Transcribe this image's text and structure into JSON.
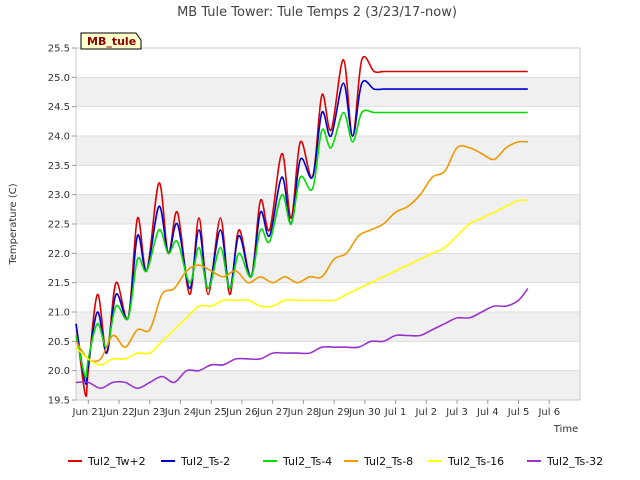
{
  "chart_data": {
    "type": "line",
    "title": "MB Tule Tower: Tule Temps 2 (3/23/17-now)",
    "site_label": "MB_tule",
    "xlabel": "Time",
    "ylabel": "Temperature (C)",
    "x_unit": "day (June/July 2017)",
    "xlim": [
      20.6,
      37.0
    ],
    "ylim": [
      19.5,
      25.5
    ],
    "x_ticks": [
      {
        "value": 21,
        "label": "Jun 21"
      },
      {
        "value": 22,
        "label": "Jun 22"
      },
      {
        "value": 23,
        "label": "Jun 23"
      },
      {
        "value": 24,
        "label": "Jun 24"
      },
      {
        "value": 25,
        "label": "Jun 25"
      },
      {
        "value": 26,
        "label": "Jun 26"
      },
      {
        "value": 27,
        "label": "Jun 27"
      },
      {
        "value": 28,
        "label": "Jun 28"
      },
      {
        "value": 29,
        "label": "Jun 29"
      },
      {
        "value": 30,
        "label": "Jun 30"
      },
      {
        "value": 31,
        "label": "Jul 1"
      },
      {
        "value": 32,
        "label": "Jul 2"
      },
      {
        "value": 33,
        "label": "Jul 3"
      },
      {
        "value": 34,
        "label": "Jul 4"
      },
      {
        "value": 35,
        "label": "Jul 5"
      },
      {
        "value": 36,
        "label": "Jul 6"
      }
    ],
    "y_ticks": [
      "19.5",
      "20.0",
      "20.5",
      "21.0",
      "21.5",
      "22.0",
      "22.5",
      "23.0",
      "23.5",
      "24.0",
      "24.5",
      "25.0",
      "25.5"
    ],
    "grid": true,
    "legend_position": "bottom",
    "series": [
      {
        "name": "Tul2_Tw+2",
        "color": "#dd0000",
        "x": [
          20.6,
          20.9,
          21.0,
          21.3,
          21.6,
          21.9,
          22.3,
          22.6,
          22.9,
          23.3,
          23.6,
          23.9,
          24.3,
          24.6,
          24.9,
          25.3,
          25.6,
          25.9,
          26.3,
          26.6,
          26.9,
          27.3,
          27.6,
          27.9,
          28.3,
          28.6,
          28.9,
          29.3,
          29.6,
          29.9,
          30.3,
          30.6,
          30.9,
          31.3,
          31.6,
          31.9,
          32.3,
          32.6,
          32.9,
          33.3,
          33.6,
          33.9,
          34.3,
          34.6,
          34.9,
          35.3
        ],
        "y": [
          20.8,
          19.6,
          20.0,
          21.3,
          20.3,
          21.5,
          20.9,
          22.6,
          21.7,
          23.2,
          22.0,
          22.7,
          21.3,
          22.6,
          21.3,
          22.6,
          21.3,
          22.4,
          21.6,
          22.9,
          22.4,
          23.7,
          22.6,
          23.9,
          23.3,
          24.7,
          24.1,
          25.3,
          24.0,
          25.3,
          25.1,
          25.1,
          25.1,
          25.1,
          25.1,
          25.1,
          25.1,
          25.1,
          25.1,
          25.1,
          25.1,
          25.1,
          25.1,
          25.1,
          25.1,
          25.1
        ]
      },
      {
        "name": "Tul2_Ts-2",
        "color": "#0000cc",
        "x": [
          20.6,
          20.9,
          21.0,
          21.3,
          21.6,
          21.9,
          22.3,
          22.6,
          22.9,
          23.3,
          23.6,
          23.9,
          24.3,
          24.6,
          24.9,
          25.3,
          25.6,
          25.9,
          26.3,
          26.6,
          26.9,
          27.3,
          27.6,
          27.9,
          28.3,
          28.6,
          28.9,
          29.3,
          29.6,
          29.9,
          30.3,
          30.6,
          30.9,
          31.3,
          31.6,
          31.9,
          32.3,
          32.6,
          32.9,
          33.3,
          33.6,
          33.9,
          34.3,
          34.6,
          34.9,
          35.3
        ],
        "y": [
          20.8,
          19.8,
          20.1,
          21.0,
          20.3,
          21.3,
          20.9,
          22.3,
          21.7,
          22.8,
          22.0,
          22.5,
          21.4,
          22.4,
          21.4,
          22.4,
          21.4,
          22.3,
          21.6,
          22.7,
          22.3,
          23.3,
          22.5,
          23.6,
          23.3,
          24.4,
          24.0,
          24.9,
          24.0,
          24.9,
          24.8,
          24.8,
          24.8,
          24.8,
          24.8,
          24.8,
          24.8,
          24.8,
          24.8,
          24.8,
          24.8,
          24.8,
          24.8,
          24.8,
          24.8,
          24.8
        ]
      },
      {
        "name": "Tul2_Ts-4",
        "color": "#00dd00",
        "x": [
          20.6,
          20.9,
          21.0,
          21.3,
          21.6,
          21.9,
          22.3,
          22.6,
          22.9,
          23.3,
          23.6,
          23.9,
          24.3,
          24.6,
          24.9,
          25.3,
          25.6,
          25.9,
          26.3,
          26.6,
          26.9,
          27.3,
          27.6,
          27.9,
          28.3,
          28.6,
          28.9,
          29.3,
          29.6,
          29.9,
          30.3,
          30.6,
          30.9,
          31.3,
          31.6,
          31.9,
          32.3,
          32.6,
          32.9,
          33.3,
          33.6,
          33.9,
          34.3,
          34.6,
          34.9,
          35.3
        ],
        "y": [
          20.6,
          19.9,
          20.2,
          20.8,
          20.4,
          21.1,
          20.9,
          21.9,
          21.7,
          22.4,
          22.0,
          22.2,
          21.5,
          22.1,
          21.4,
          22.1,
          21.4,
          22.0,
          21.6,
          22.4,
          22.2,
          23.0,
          22.5,
          23.3,
          23.1,
          24.1,
          23.8,
          24.4,
          23.9,
          24.4,
          24.4,
          24.4,
          24.4,
          24.4,
          24.4,
          24.4,
          24.4,
          24.4,
          24.4,
          24.4,
          24.4,
          24.4,
          24.4,
          24.4,
          24.4,
          24.4
        ]
      },
      {
        "name": "Tul2_Ts-8",
        "color": "#ee9900",
        "x": [
          20.6,
          21.0,
          21.4,
          21.8,
          22.2,
          22.6,
          23.0,
          23.4,
          23.8,
          24.2,
          24.6,
          25.0,
          25.4,
          25.8,
          26.2,
          26.6,
          27.0,
          27.4,
          27.8,
          28.2,
          28.6,
          29.0,
          29.4,
          29.8,
          30.2,
          30.6,
          31.0,
          31.4,
          31.8,
          32.2,
          32.6,
          33.0,
          33.4,
          33.8,
          34.2,
          34.6,
          35.0,
          35.3
        ],
        "y": [
          20.5,
          20.2,
          20.2,
          20.6,
          20.4,
          20.7,
          20.7,
          21.3,
          21.4,
          21.7,
          21.8,
          21.7,
          21.6,
          21.7,
          21.5,
          21.6,
          21.5,
          21.6,
          21.5,
          21.6,
          21.6,
          21.9,
          22.0,
          22.3,
          22.4,
          22.5,
          22.7,
          22.8,
          23.0,
          23.3,
          23.4,
          23.8,
          23.8,
          23.7,
          23.6,
          23.8,
          23.9,
          23.9
        ]
      },
      {
        "name": "Tul2_Ts-16",
        "color": "#ffff00",
        "x": [
          20.6,
          21.0,
          21.4,
          21.8,
          22.2,
          22.6,
          23.0,
          23.4,
          23.8,
          24.2,
          24.6,
          25.0,
          25.4,
          25.8,
          26.2,
          26.6,
          27.0,
          27.4,
          27.8,
          28.2,
          28.6,
          29.0,
          29.4,
          29.8,
          30.2,
          30.6,
          31.0,
          31.4,
          31.8,
          32.2,
          32.6,
          33.0,
          33.4,
          33.8,
          34.2,
          34.6,
          35.0,
          35.3
        ],
        "y": [
          20.4,
          20.2,
          20.1,
          20.2,
          20.2,
          20.3,
          20.3,
          20.5,
          20.7,
          20.9,
          21.1,
          21.1,
          21.2,
          21.2,
          21.2,
          21.1,
          21.1,
          21.2,
          21.2,
          21.2,
          21.2,
          21.2,
          21.3,
          21.4,
          21.5,
          21.6,
          21.7,
          21.8,
          21.9,
          22.0,
          22.1,
          22.3,
          22.5,
          22.6,
          22.7,
          22.8,
          22.9,
          22.9
        ]
      },
      {
        "name": "Tul2_Ts-32",
        "color": "#9933cc",
        "x": [
          20.6,
          21.0,
          21.4,
          21.8,
          22.2,
          22.6,
          23.0,
          23.4,
          23.8,
          24.2,
          24.6,
          25.0,
          25.4,
          25.8,
          26.2,
          26.6,
          27.0,
          27.4,
          27.8,
          28.2,
          28.6,
          29.0,
          29.4,
          29.8,
          30.2,
          30.6,
          31.0,
          31.4,
          31.8,
          32.2,
          32.6,
          33.0,
          33.4,
          33.8,
          34.2,
          34.6,
          35.0,
          35.3
        ],
        "y": [
          19.8,
          19.8,
          19.7,
          19.8,
          19.8,
          19.7,
          19.8,
          19.9,
          19.8,
          20.0,
          20.0,
          20.1,
          20.1,
          20.2,
          20.2,
          20.2,
          20.3,
          20.3,
          20.3,
          20.3,
          20.4,
          20.4,
          20.4,
          20.4,
          20.5,
          20.5,
          20.6,
          20.6,
          20.6,
          20.7,
          20.8,
          20.9,
          20.9,
          21.0,
          21.1,
          21.1,
          21.2,
          21.4
        ]
      }
    ]
  }
}
